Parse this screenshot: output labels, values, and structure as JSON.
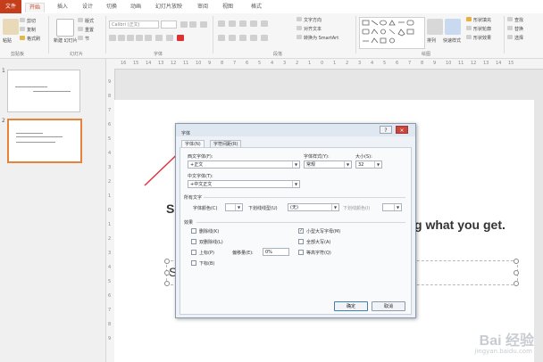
{
  "tabs": {
    "file": "文件",
    "home": "开始",
    "insert": "插入",
    "design": "设计",
    "transitions": "切换",
    "animations": "动画",
    "slideshow": "幻灯片放映",
    "review": "审阅",
    "view": "视图",
    "format": "格式"
  },
  "ribbon": {
    "paste": "粘贴",
    "cut": "剪切",
    "copy": "复制",
    "format_painter": "格式刷",
    "clipboard_group": "剪贴板",
    "new_slide": "新建\n幻灯片",
    "layout": "版式",
    "reset": "重置",
    "section": "节",
    "slides_group": "幻灯片",
    "font_combo": "Calibri (正文)",
    "font_group": "字体",
    "text_direction": "文字方向",
    "align_text": "对齐文本",
    "smartart": "转换为 SmartArt",
    "paragraph_group": "段落",
    "arrange": "排列",
    "quick_styles": "快速样式",
    "shape_fill": "形状填充",
    "shape_outline": "形状轮廓",
    "shape_effects": "形状效果",
    "drawing_group": "绘图",
    "find": "查找",
    "replace": "替换",
    "select": "选择"
  },
  "ruler": {
    "h_marks": [
      "16",
      "15",
      "14",
      "13",
      "12",
      "11",
      "10",
      "9",
      "8",
      "7",
      "6",
      "5",
      "4",
      "3",
      "2",
      "1",
      "0",
      "1",
      "2",
      "3",
      "4",
      "5",
      "6",
      "7",
      "8",
      "9",
      "10",
      "11",
      "12",
      "13",
      "14",
      "15"
    ],
    "v_marks": [
      "9",
      "8",
      "7",
      "6",
      "5",
      "4",
      "3",
      "2",
      "1",
      "0",
      "1",
      "2",
      "3",
      "4",
      "5",
      "6",
      "7",
      "8",
      "9"
    ]
  },
  "slides": {
    "slide1_number": "1",
    "slide2_number": "2"
  },
  "slide": {
    "left_fragment": "S",
    "right_text": "g what you get.",
    "box_fragment": "S"
  },
  "dialog": {
    "title": "字体",
    "help_btn": "?",
    "close_btn": "×",
    "tab_font": "字体(N)",
    "tab_spacing": "字符间距(R)",
    "western_font_label": "西文字体(F):",
    "western_font_value": "+正文",
    "font_style_label": "字体样式(Y):",
    "font_style_value": "常规",
    "size_label": "大小(S):",
    "size_value": "32",
    "asian_font_label": "中文字体(T):",
    "asian_font_value": "+中文正文",
    "all_text_label": "所有文字",
    "font_color_label": "字体颜色(C)",
    "underline_style_label": "下划线线型(U)",
    "underline_style_value": "(无)",
    "underline_color_label": "下划线颜色(I)",
    "effects_label": "效果",
    "strike": "删除线(K)",
    "double_strike": "双删除线(L)",
    "superscript": "上标(P)",
    "subscript": "下标(B)",
    "offset_label": "偏移量(E):",
    "offset_value": "0%",
    "small_caps": "小型大写字母(M)",
    "all_caps": "全部大写(A)",
    "equalize": "等高字符(Q)",
    "ok": "确定",
    "cancel": "取消"
  },
  "watermark": {
    "brand": "Bai 经验",
    "url": "jingyan.baidu.com"
  },
  "colors": {
    "file_tab": "#c43e1c",
    "arrow": "#e0303a",
    "dialog_bg": "#eef2f7"
  }
}
